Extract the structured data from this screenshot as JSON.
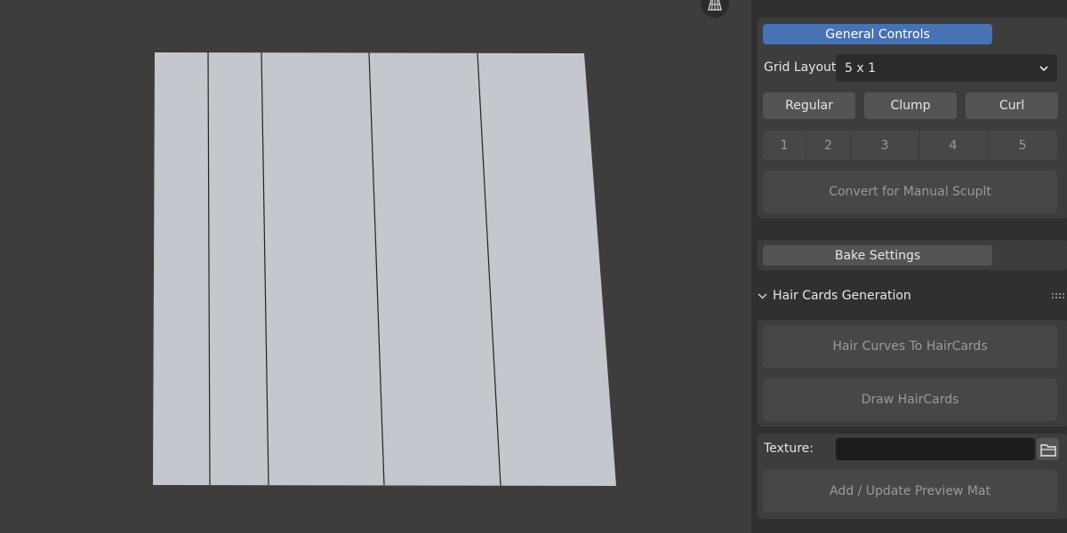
{
  "panel": {
    "general_controls": {
      "header_label": "General Controls",
      "grid_layout_label": "Grid Layout:",
      "grid_layout_value": "5 x 1",
      "mode_buttons": [
        "Regular",
        "Clump",
        "Curl"
      ],
      "card_indices": [
        "1",
        "2",
        "3",
        "4",
        "5"
      ],
      "convert_label": "Convert for Manual Scuplt"
    },
    "bake": {
      "header_label": "Bake Settings"
    },
    "generation": {
      "section_title": "Hair Cards Generation",
      "curves_button": "Hair Curves To HairCards",
      "draw_button": "Draw HairCards"
    },
    "texture": {
      "label": "Texture:",
      "value": "",
      "preview_button": "Add / Update Preview Mat"
    }
  },
  "icons": {
    "viewport_gizmo": "grid-icon",
    "section_toggle": "chevron-down-icon",
    "drag_handle": "drag-handle-icon",
    "dropdown": "chevron-down-icon",
    "file_browser": "folder-icon"
  },
  "colors": {
    "viewport_bg": "#3d3d3d",
    "panel_bg": "#303030",
    "active_tab": "#4772b3",
    "mesh_fill": "#c4c7ce"
  }
}
